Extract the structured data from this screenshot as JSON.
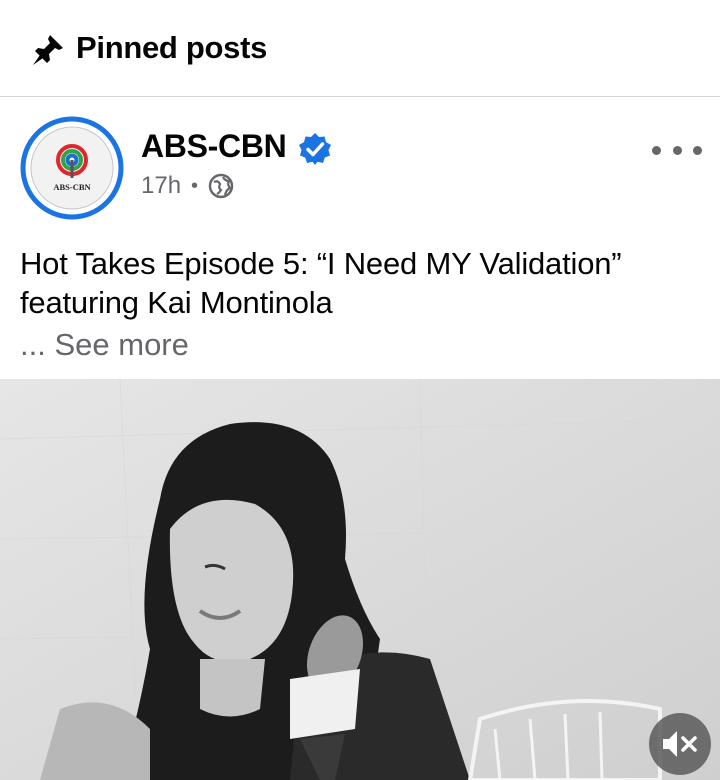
{
  "section": {
    "title": "Pinned posts",
    "icon": "pin-icon"
  },
  "post": {
    "author": {
      "name": "ABS-CBN",
      "avatar_logo_text": "ABS-CBN",
      "verified": true,
      "verified_icon": "verified-badge-icon"
    },
    "time": "17h",
    "separator": "•",
    "audience_icon": "globe-icon",
    "menu_icon": "more-options-icon",
    "text_line1": "Hot Takes Episode 5: “I Need MY Validation”",
    "text_line2": "featuring Kai Montinola",
    "ellipsis": "...",
    "see_more": "See more",
    "media": {
      "type": "video",
      "tone": "black-and-white",
      "mute_icon": "mute-icon"
    }
  },
  "colors": {
    "accent": "#1b74e4",
    "secondary_text": "#65676b",
    "divider": "#d4d4d4"
  }
}
